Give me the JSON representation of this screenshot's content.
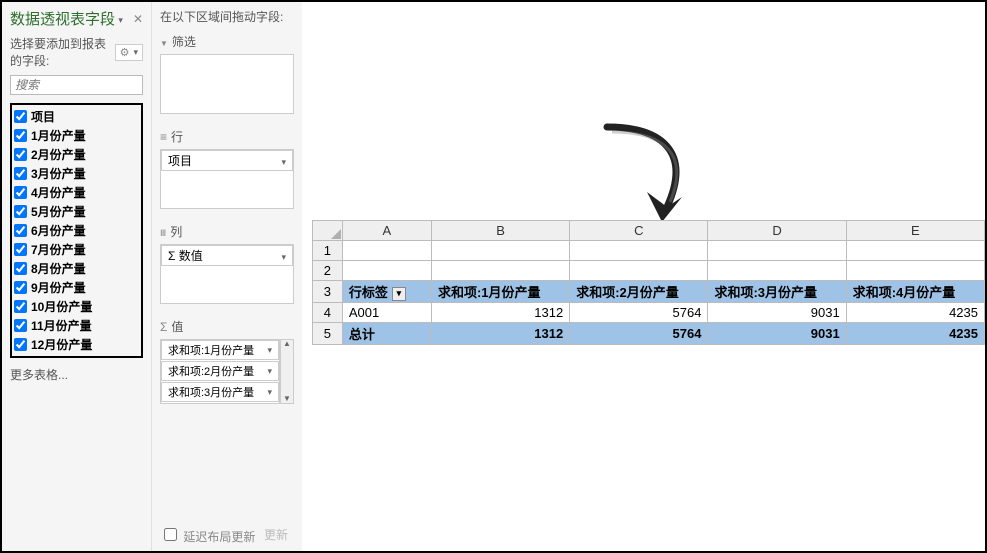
{
  "pane": {
    "title": "数据透视表字段",
    "choose_label": "选择要添加到报表的字段:",
    "search_placeholder": "搜索",
    "more_tables": "更多表格...",
    "fields": [
      {
        "label": "项目",
        "checked": true
      },
      {
        "label": "1月份产量",
        "checked": true
      },
      {
        "label": "2月份产量",
        "checked": true
      },
      {
        "label": "3月份产量",
        "checked": true
      },
      {
        "label": "4月份产量",
        "checked": true
      },
      {
        "label": "5月份产量",
        "checked": true
      },
      {
        "label": "6月份产量",
        "checked": true
      },
      {
        "label": "7月份产量",
        "checked": true
      },
      {
        "label": "8月份产量",
        "checked": true
      },
      {
        "label": "9月份产量",
        "checked": true
      },
      {
        "label": "10月份产量",
        "checked": true
      },
      {
        "label": "11月份产量",
        "checked": true
      },
      {
        "label": "12月份产量",
        "checked": true
      }
    ]
  },
  "areas": {
    "drag_title": "在以下区域间拖动字段:",
    "filter": {
      "label": "筛选"
    },
    "rows": {
      "label": "行",
      "items": [
        "项目"
      ]
    },
    "cols": {
      "label": "列",
      "items": [
        "Σ 数值"
      ]
    },
    "vals": {
      "label": "值",
      "items": [
        "求和项:1月份产量",
        "求和项:2月份产量",
        "求和项:3月份产量"
      ]
    },
    "defer_label": "延迟布局更新",
    "update_btn": "更新"
  },
  "sheet": {
    "col_letters": [
      "A",
      "B",
      "C",
      "D",
      "E"
    ],
    "rows": [
      {
        "n": 1,
        "cells": [
          "",
          "",
          "",
          "",
          ""
        ]
      },
      {
        "n": 2,
        "cells": [
          "",
          "",
          "",
          "",
          ""
        ]
      },
      {
        "n": 3,
        "kind": "hdr",
        "cells": [
          "行标签",
          "求和项:1月份产量",
          "求和项:2月份产量",
          "求和项:3月份产量",
          "求和项:4月份产量"
        ]
      },
      {
        "n": 4,
        "cells": [
          "A001",
          "1312",
          "5764",
          "9031",
          "4235"
        ]
      },
      {
        "n": 5,
        "kind": "total",
        "cells": [
          "总计",
          "1312",
          "5764",
          "9031",
          "4235"
        ]
      }
    ]
  }
}
